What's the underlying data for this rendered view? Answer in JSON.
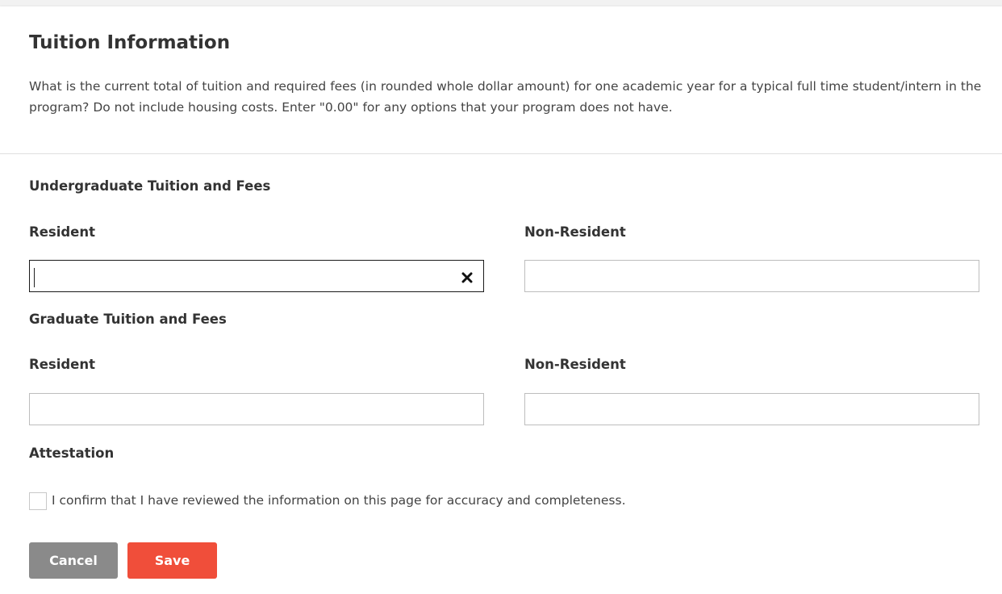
{
  "header": {
    "title": "Tuition Information",
    "description": "What is the current total of tuition and required fees (in rounded whole dollar amount) for one academic year for a typical full time student/intern in the program? Do not include housing costs. Enter \"0.00\" for any options that your program does not have."
  },
  "undergraduate": {
    "section_title": "Undergraduate Tuition and Fees",
    "resident_label": "Resident",
    "resident_value": "",
    "non_resident_label": "Non-Resident",
    "non_resident_value": ""
  },
  "graduate": {
    "section_title": "Graduate Tuition and Fees",
    "resident_label": "Resident",
    "resident_value": "",
    "non_resident_label": "Non-Resident",
    "non_resident_value": ""
  },
  "attestation": {
    "section_title": "Attestation",
    "checkbox_label": "I confirm that I have reviewed the information on this page for accuracy and completeness.",
    "checked": false
  },
  "actions": {
    "cancel_label": "Cancel",
    "save_label": "Save"
  },
  "icons": {
    "clear": "close-icon"
  },
  "colors": {
    "cancel_button": "#8a8a8a",
    "save_button": "#f04e3a"
  }
}
